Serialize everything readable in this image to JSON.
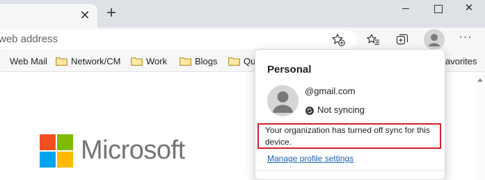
{
  "tabstrip": {
    "close_tab_glyph": "✕",
    "new_tab_glyph": "+",
    "window_controls": {
      "close_glyph": "✕"
    }
  },
  "toolbar": {
    "address_placeholder": "web address",
    "more_glyph": "···",
    "icons": [
      "star-add-icon",
      "favorites-icon",
      "collections-icon",
      "profile-icon",
      "more-icon"
    ]
  },
  "favorites_bar": {
    "items": [
      {
        "label": "Web Mail",
        "has_folder": false
      },
      {
        "label": "Network/CM",
        "has_folder": true
      },
      {
        "label": "Work",
        "has_folder": true
      },
      {
        "label": "Blogs",
        "has_folder": true
      },
      {
        "label": "Qu",
        "has_folder": true
      }
    ],
    "other": "avorites"
  },
  "page": {
    "logo_text": "Microsoft",
    "logo_colors": {
      "red": "#f25022",
      "green": "#7fba00",
      "blue": "#00a4ef",
      "yellow": "#ffb900"
    }
  },
  "profile_flyout": {
    "title": "Personal",
    "email": "@gmail.com",
    "sync_status": "Not syncing",
    "alert": "Your organization has turned off sync for this device.",
    "alert_border_color": "#d0202a",
    "manage_link": "Manage profile settings"
  }
}
